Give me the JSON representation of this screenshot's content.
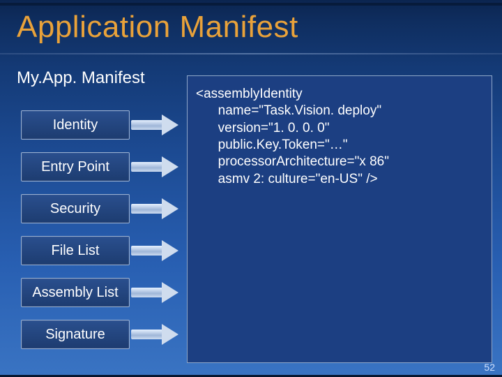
{
  "title": "Application Manifest",
  "subtitle": "My.App. Manifest",
  "boxes": [
    "Identity",
    "Entry Point",
    "Security",
    "File List",
    "Assembly List",
    "Signature"
  ],
  "code_lines": [
    "<assemblyIdentity",
    "      name=\"Task.Vision. deploy\"",
    "      version=\"1. 0. 0. 0\"",
    "      public.Key.Token=\"…\"",
    "      processorArchitecture=\"x 86\"",
    "      asmv 2: culture=\"en-US\" />"
  ],
  "page_number": "52"
}
